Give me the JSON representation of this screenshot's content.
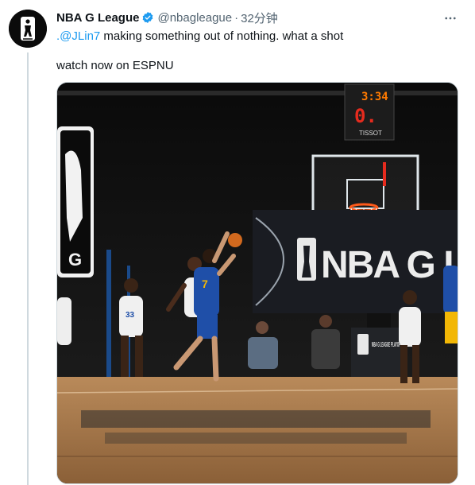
{
  "tweet": {
    "display_name": "NBA G League",
    "handle": "@nbagleague",
    "separator": "·",
    "timestamp": "32分钟",
    "mention": "@JLin7",
    "mention_prefix": ".",
    "body_line1": " making something out of nothing. what a shot",
    "body_line2": "watch now on ESPNU"
  },
  "video": {
    "shot_clock": "3:34",
    "shot_clock_sub": "0.",
    "scoreboard_brand": "TISSOT",
    "banner_text": "NBA G LE",
    "court_sign": "G",
    "playoffs_sign": "NBA G LEAGUE PLAYOFFS",
    "player_numbers": [
      "7",
      "33"
    ]
  },
  "colors": {
    "verified_badge": "#1d9bf0",
    "link": "#1d9bf0",
    "scoreboard_digits": "#ff7a00",
    "scoreboard_red": "#e52b1e",
    "jersey_blue": "#1f4fa8",
    "jersey_gold": "#f2b705"
  },
  "icons": {
    "verified": "verified-badge-icon",
    "more": "more-horizontal-icon",
    "avatar": "nba-g-league-logo"
  }
}
